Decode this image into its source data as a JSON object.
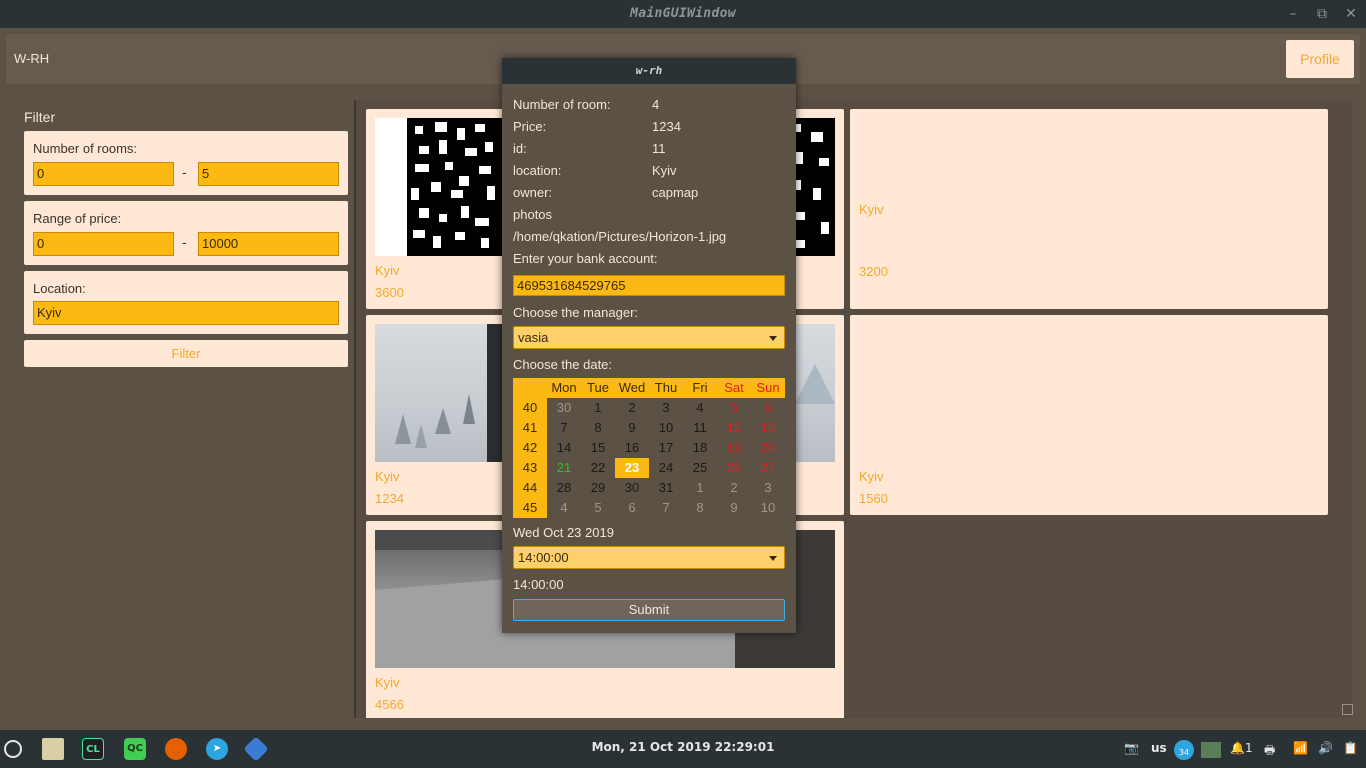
{
  "window": {
    "title": "MainGUIWindow"
  },
  "header": {
    "brand": "W-RH",
    "profile_label": "Profile"
  },
  "filter": {
    "title": "Filter",
    "rooms_label": "Number of rooms:",
    "rooms_min": "0",
    "rooms_max": "5",
    "price_label": "Range of price:",
    "price_min": "0",
    "price_max": "10000",
    "location_label": "Location:",
    "location_value": "Kyiv",
    "dash": "-",
    "button_label": "Filter"
  },
  "listings": [
    {
      "location": "Kyiv",
      "price": "3600"
    },
    {
      "location": "Kyiv",
      "price": "3200"
    },
    {
      "location": "Kyiv",
      "price": "1234"
    },
    {
      "location": "Kyiv",
      "price": "1560"
    },
    {
      "location": "Kyiv",
      "price": "4566"
    }
  ],
  "dialog": {
    "title": "w-rh",
    "rows": [
      {
        "label": "Number of room:",
        "value": "4"
      },
      {
        "label": "Price:",
        "value": "1234"
      },
      {
        "label": "id:",
        "value": "11"
      },
      {
        "label": "location:",
        "value": "Kyiv"
      },
      {
        "label": "owner:",
        "value": "capmap"
      }
    ],
    "photos_label": "photos",
    "photo_path": "/home/qkation/Pictures/Horizon-1.jpg",
    "bank_label": "Enter your bank account:",
    "bank_value": "469531684529765",
    "manager_label": "Choose the manager:",
    "manager_value": "vasia",
    "date_label": "Choose the date:",
    "calendar": {
      "day_names": [
        "Mon",
        "Tue",
        "Wed",
        "Thu",
        "Fri",
        "Sat",
        "Sun"
      ],
      "weeks": [
        "40",
        "41",
        "42",
        "43",
        "44",
        "45"
      ],
      "days": [
        [
          "30",
          "1",
          "2",
          "3",
          "4",
          "5",
          "6"
        ],
        [
          "7",
          "8",
          "9",
          "10",
          "11",
          "12",
          "13"
        ],
        [
          "14",
          "15",
          "16",
          "17",
          "18",
          "19",
          "20"
        ],
        [
          "21",
          "22",
          "23",
          "24",
          "25",
          "26",
          "27"
        ],
        [
          "28",
          "29",
          "30",
          "31",
          "1",
          "2",
          "3"
        ],
        [
          "4",
          "5",
          "6",
          "7",
          "8",
          "9",
          "10"
        ]
      ],
      "selected_day": "23",
      "today_day": "21"
    },
    "selected_date_text": "Wed Oct 23 2019",
    "time_value": "14:00:00",
    "time_text": "14:00:00",
    "submit_label": "Submit"
  },
  "taskbar": {
    "clock": "Mon, 21 Oct 2019 22:29:01",
    "layout": "us",
    "notif_count": "1",
    "telegram_badge": "34"
  }
}
